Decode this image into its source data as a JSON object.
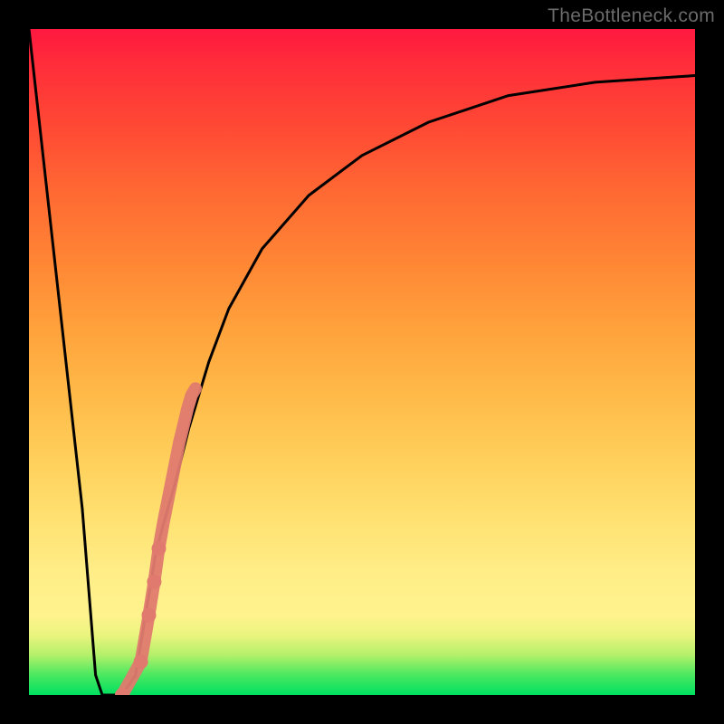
{
  "watermark": "TheBottleneck.com",
  "chart_data": {
    "type": "line",
    "title": "",
    "xlabel": "",
    "ylabel": "",
    "xlim": [
      0,
      100
    ],
    "ylim": [
      0,
      100
    ],
    "series": [
      {
        "name": "bottleneck-curve",
        "x": [
          0,
          8,
          10,
          11,
          14,
          16,
          18,
          19,
          20,
          22,
          24,
          27,
          30,
          35,
          42,
          50,
          60,
          72,
          85,
          100
        ],
        "values": [
          100,
          28,
          3,
          0,
          0,
          3,
          15,
          21,
          25,
          32,
          40,
          50,
          58,
          67,
          75,
          81,
          86,
          90,
          92,
          93
        ]
      }
    ],
    "highlight_points": {
      "name": "gpu-dots",
      "color": "#e07a6f",
      "x": [
        14.0,
        16.8,
        18.0,
        18.8,
        19.5,
        20.2,
        20.8,
        21.4,
        22.0,
        22.6,
        23.2,
        23.8,
        24.4,
        25.0
      ],
      "values": [
        0.0,
        5.0,
        12.0,
        17.0,
        22.0,
        26.0,
        29.0,
        32.0,
        35.0,
        38.0,
        40.5,
        43.0,
        45.0,
        46.0
      ]
    }
  }
}
